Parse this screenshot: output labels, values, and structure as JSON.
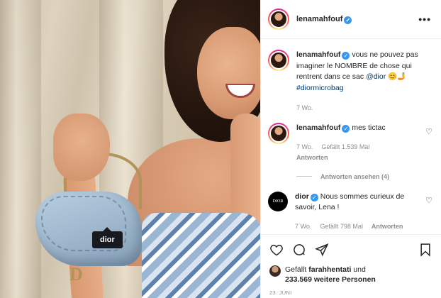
{
  "photo": {
    "tag_label": "dior"
  },
  "header": {
    "username": "lenamahfouf",
    "more_label": "•••"
  },
  "caption": {
    "username": "lenamahfouf",
    "text": "vous ne pouvez pas imaginer le NOMBRE de chose qui rentrent dans ce sac",
    "mention": "@dior",
    "emoji": "😊🤳",
    "hashtag": "#diormicrobag",
    "time": "7 Wo."
  },
  "comments": [
    {
      "username": "lenamahfouf",
      "text": "mes tictac",
      "time": "7 Wo.",
      "likes": "Gefällt 1.539 Mal",
      "reply": "Antworten"
    },
    {
      "username": "dior",
      "avatar_text": "DIOR",
      "text": "Nous sommes curieux de savoir, Lena !",
      "time": "7 Wo.",
      "likes": "Gefällt 798 Mal",
      "reply": "Antworten"
    }
  ],
  "view_replies": "Antworten ansehen (4)",
  "likes_line": {
    "prefix": "Gefällt",
    "user": "farahhentati",
    "suffix": "und",
    "count": "233.569 weitere Personen"
  },
  "date": "23. JUNI",
  "colors": {
    "verified": "#3897f0",
    "link": "#00376b",
    "muted": "#8e8e8e"
  }
}
